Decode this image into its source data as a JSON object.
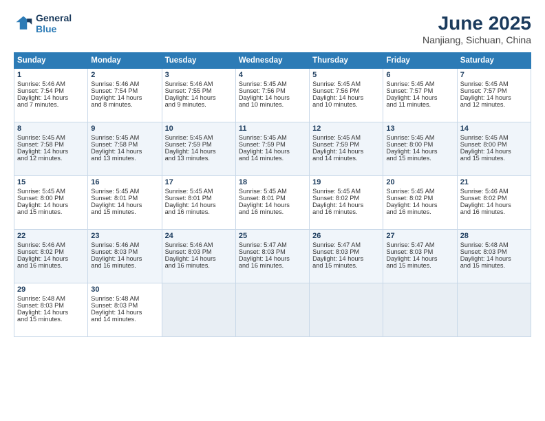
{
  "logo": {
    "line1": "General",
    "line2": "Blue"
  },
  "title": "June 2025",
  "location": "Nanjiang, Sichuan, China",
  "days_header": [
    "Sunday",
    "Monday",
    "Tuesday",
    "Wednesday",
    "Thursday",
    "Friday",
    "Saturday"
  ],
  "weeks": [
    [
      {
        "day": "1",
        "lines": [
          "Sunrise: 5:46 AM",
          "Sunset: 7:54 PM",
          "Daylight: 14 hours",
          "and 7 minutes."
        ]
      },
      {
        "day": "2",
        "lines": [
          "Sunrise: 5:46 AM",
          "Sunset: 7:54 PM",
          "Daylight: 14 hours",
          "and 8 minutes."
        ]
      },
      {
        "day": "3",
        "lines": [
          "Sunrise: 5:46 AM",
          "Sunset: 7:55 PM",
          "Daylight: 14 hours",
          "and 9 minutes."
        ]
      },
      {
        "day": "4",
        "lines": [
          "Sunrise: 5:45 AM",
          "Sunset: 7:56 PM",
          "Daylight: 14 hours",
          "and 10 minutes."
        ]
      },
      {
        "day": "5",
        "lines": [
          "Sunrise: 5:45 AM",
          "Sunset: 7:56 PM",
          "Daylight: 14 hours",
          "and 10 minutes."
        ]
      },
      {
        "day": "6",
        "lines": [
          "Sunrise: 5:45 AM",
          "Sunset: 7:57 PM",
          "Daylight: 14 hours",
          "and 11 minutes."
        ]
      },
      {
        "day": "7",
        "lines": [
          "Sunrise: 5:45 AM",
          "Sunset: 7:57 PM",
          "Daylight: 14 hours",
          "and 12 minutes."
        ]
      }
    ],
    [
      {
        "day": "8",
        "lines": [
          "Sunrise: 5:45 AM",
          "Sunset: 7:58 PM",
          "Daylight: 14 hours",
          "and 12 minutes."
        ]
      },
      {
        "day": "9",
        "lines": [
          "Sunrise: 5:45 AM",
          "Sunset: 7:58 PM",
          "Daylight: 14 hours",
          "and 13 minutes."
        ]
      },
      {
        "day": "10",
        "lines": [
          "Sunrise: 5:45 AM",
          "Sunset: 7:59 PM",
          "Daylight: 14 hours",
          "and 13 minutes."
        ]
      },
      {
        "day": "11",
        "lines": [
          "Sunrise: 5:45 AM",
          "Sunset: 7:59 PM",
          "Daylight: 14 hours",
          "and 14 minutes."
        ]
      },
      {
        "day": "12",
        "lines": [
          "Sunrise: 5:45 AM",
          "Sunset: 7:59 PM",
          "Daylight: 14 hours",
          "and 14 minutes."
        ]
      },
      {
        "day": "13",
        "lines": [
          "Sunrise: 5:45 AM",
          "Sunset: 8:00 PM",
          "Daylight: 14 hours",
          "and 15 minutes."
        ]
      },
      {
        "day": "14",
        "lines": [
          "Sunrise: 5:45 AM",
          "Sunset: 8:00 PM",
          "Daylight: 14 hours",
          "and 15 minutes."
        ]
      }
    ],
    [
      {
        "day": "15",
        "lines": [
          "Sunrise: 5:45 AM",
          "Sunset: 8:00 PM",
          "Daylight: 14 hours",
          "and 15 minutes."
        ]
      },
      {
        "day": "16",
        "lines": [
          "Sunrise: 5:45 AM",
          "Sunset: 8:01 PM",
          "Daylight: 14 hours",
          "and 15 minutes."
        ]
      },
      {
        "day": "17",
        "lines": [
          "Sunrise: 5:45 AM",
          "Sunset: 8:01 PM",
          "Daylight: 14 hours",
          "and 16 minutes."
        ]
      },
      {
        "day": "18",
        "lines": [
          "Sunrise: 5:45 AM",
          "Sunset: 8:01 PM",
          "Daylight: 14 hours",
          "and 16 minutes."
        ]
      },
      {
        "day": "19",
        "lines": [
          "Sunrise: 5:45 AM",
          "Sunset: 8:02 PM",
          "Daylight: 14 hours",
          "and 16 minutes."
        ]
      },
      {
        "day": "20",
        "lines": [
          "Sunrise: 5:45 AM",
          "Sunset: 8:02 PM",
          "Daylight: 14 hours",
          "and 16 minutes."
        ]
      },
      {
        "day": "21",
        "lines": [
          "Sunrise: 5:46 AM",
          "Sunset: 8:02 PM",
          "Daylight: 14 hours",
          "and 16 minutes."
        ]
      }
    ],
    [
      {
        "day": "22",
        "lines": [
          "Sunrise: 5:46 AM",
          "Sunset: 8:02 PM",
          "Daylight: 14 hours",
          "and 16 minutes."
        ]
      },
      {
        "day": "23",
        "lines": [
          "Sunrise: 5:46 AM",
          "Sunset: 8:03 PM",
          "Daylight: 14 hours",
          "and 16 minutes."
        ]
      },
      {
        "day": "24",
        "lines": [
          "Sunrise: 5:46 AM",
          "Sunset: 8:03 PM",
          "Daylight: 14 hours",
          "and 16 minutes."
        ]
      },
      {
        "day": "25",
        "lines": [
          "Sunrise: 5:47 AM",
          "Sunset: 8:03 PM",
          "Daylight: 14 hours",
          "and 16 minutes."
        ]
      },
      {
        "day": "26",
        "lines": [
          "Sunrise: 5:47 AM",
          "Sunset: 8:03 PM",
          "Daylight: 14 hours",
          "and 15 minutes."
        ]
      },
      {
        "day": "27",
        "lines": [
          "Sunrise: 5:47 AM",
          "Sunset: 8:03 PM",
          "Daylight: 14 hours",
          "and 15 minutes."
        ]
      },
      {
        "day": "28",
        "lines": [
          "Sunrise: 5:48 AM",
          "Sunset: 8:03 PM",
          "Daylight: 14 hours",
          "and 15 minutes."
        ]
      }
    ],
    [
      {
        "day": "29",
        "lines": [
          "Sunrise: 5:48 AM",
          "Sunset: 8:03 PM",
          "Daylight: 14 hours",
          "and 15 minutes."
        ]
      },
      {
        "day": "30",
        "lines": [
          "Sunrise: 5:48 AM",
          "Sunset: 8:03 PM",
          "Daylight: 14 hours",
          "and 14 minutes."
        ]
      },
      {
        "day": "",
        "lines": []
      },
      {
        "day": "",
        "lines": []
      },
      {
        "day": "",
        "lines": []
      },
      {
        "day": "",
        "lines": []
      },
      {
        "day": "",
        "lines": []
      }
    ]
  ]
}
